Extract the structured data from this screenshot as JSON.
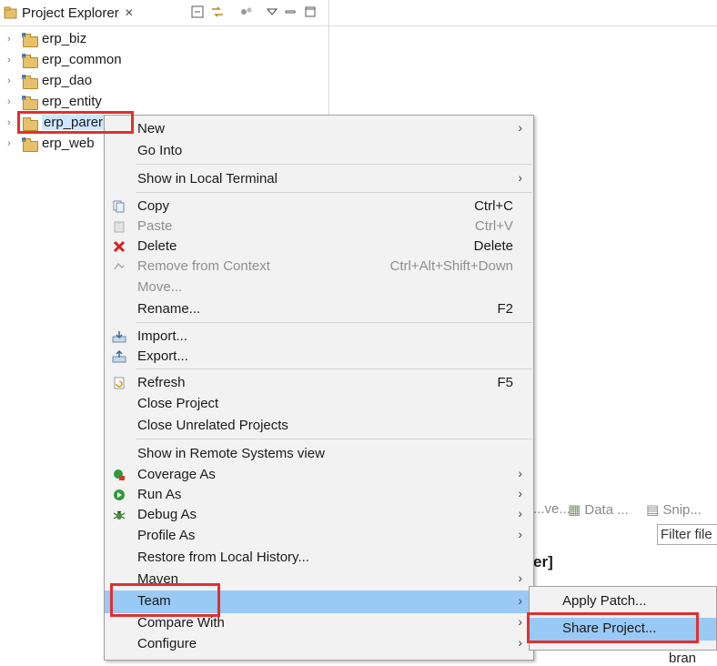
{
  "explorer": {
    "title": "Project Explorer",
    "close_icon": "close-x-icon",
    "toolbar": [
      "collapse-all-icon",
      "link-with-editor-icon",
      "filters-icon",
      "view-menu-icon",
      "minimize-icon",
      "maximize-icon"
    ],
    "projects": [
      {
        "label": "erp_biz"
      },
      {
        "label": "erp_common"
      },
      {
        "label": "erp_dao"
      },
      {
        "label": "erp_entity"
      },
      {
        "label": "erp_parer"
      },
      {
        "label": "erp_web"
      }
    ]
  },
  "context_menu": {
    "items": {
      "new": {
        "label": "New",
        "submenu": true
      },
      "go_into": {
        "label": "Go Into"
      },
      "show_local_terminal": {
        "label": "Show in Local Terminal",
        "submenu": true
      },
      "copy": {
        "label": "Copy",
        "shortcut": "Ctrl+C"
      },
      "paste": {
        "label": "Paste",
        "shortcut": "Ctrl+V",
        "disabled": true
      },
      "delete": {
        "label": "Delete",
        "shortcut": "Delete"
      },
      "remove_from_context": {
        "label": "Remove from Context",
        "shortcut": "Ctrl+Alt+Shift+Down",
        "disabled": true
      },
      "move": {
        "label": "Move...",
        "disabled": true
      },
      "rename": {
        "label": "Rename...",
        "shortcut": "F2"
      },
      "import": {
        "label": "Import..."
      },
      "export": {
        "label": "Export..."
      },
      "refresh": {
        "label": "Refresh",
        "shortcut": "F5"
      },
      "close_project": {
        "label": "Close Project"
      },
      "close_unrelated": {
        "label": "Close Unrelated Projects"
      },
      "show_remote": {
        "label": "Show in Remote Systems view"
      },
      "coverage_as": {
        "label": "Coverage As",
        "submenu": true
      },
      "run_as": {
        "label": "Run As",
        "submenu": true
      },
      "debug_as": {
        "label": "Debug As",
        "submenu": true
      },
      "profile_as": {
        "label": "Profile As",
        "submenu": true
      },
      "restore_history": {
        "label": "Restore from Local History..."
      },
      "maven": {
        "label": "Maven",
        "submenu": true
      },
      "team": {
        "label": "Team",
        "submenu": true,
        "highlighted": true
      },
      "compare_with": {
        "label": "Compare With",
        "submenu": true
      },
      "configure": {
        "label": "Configure",
        "submenu": true
      }
    }
  },
  "team_submenu": {
    "apply_patch": {
      "label": "Apply Patch..."
    },
    "share_project": {
      "label": "Share Project...",
      "highlighted": true
    }
  },
  "background": {
    "tab1": "...ve...",
    "tab2": "Data ...",
    "tab3": "Snip...",
    "filter": "Filter file",
    "heading_fragment": "er]",
    "text_fragment": "the bran"
  },
  "colors": {
    "menu_bg": "#f2f2f2",
    "highlight": "#99c9f5",
    "annotation_red": "#e03030"
  }
}
